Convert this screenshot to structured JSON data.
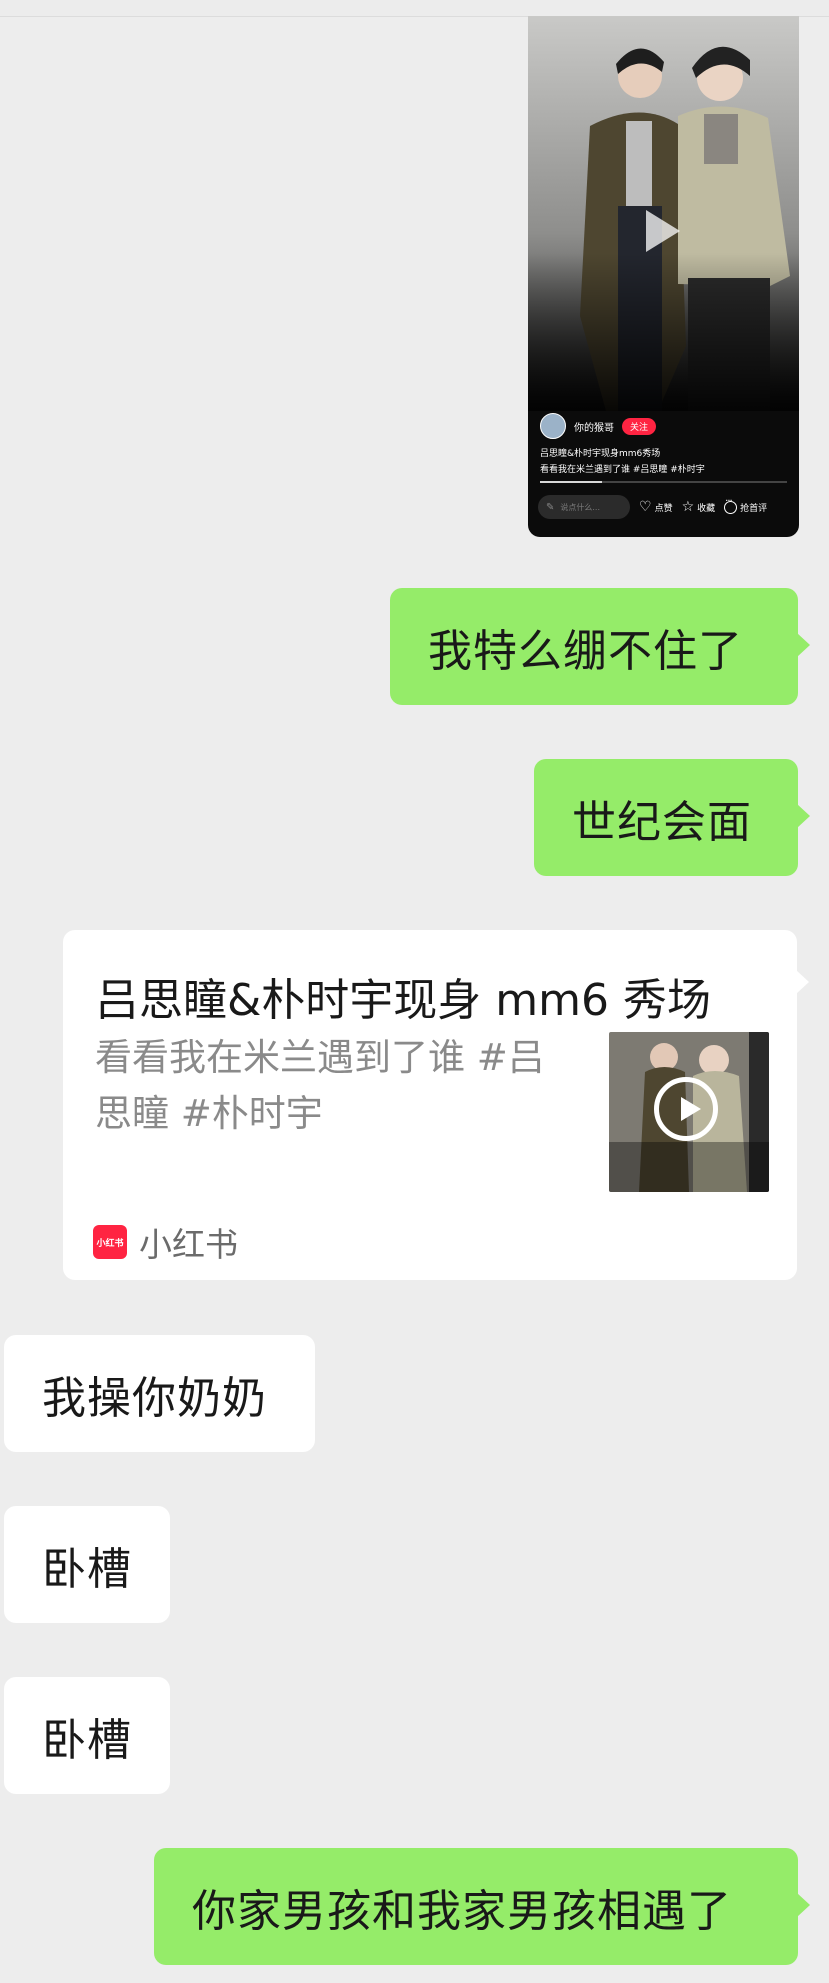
{
  "shared_video": {
    "author": "你的猴哥",
    "follow_label": "关注",
    "title": "吕思瞳&朴时宇现身mm6秀场",
    "desc": "看看我在米兰遇到了谁 #吕思瞳 #朴时宇",
    "progress": 0.25,
    "comment_placeholder": "说点什么...",
    "like_label": "点赞",
    "collect_label": "收藏",
    "comment_label": "抢首评"
  },
  "messages": [
    {
      "side": "me",
      "text": "我特么绷不住了"
    },
    {
      "side": "me",
      "text": "世纪会面"
    },
    {
      "side": "other",
      "text": "我操你奶奶"
    },
    {
      "side": "other",
      "text": "卧槽"
    },
    {
      "side": "other",
      "text": "卧槽"
    },
    {
      "side": "me",
      "text": "你家男孩和我家男孩相遇了"
    }
  ],
  "link_card": {
    "title": "吕思瞳&朴时宇现身 mm6 秀场",
    "desc": "看看我在米兰遇到了谁 #吕思瞳  #朴时宇",
    "source_logo": "小红书",
    "source_name": "小红书"
  },
  "colors": {
    "background": "#ededed",
    "my_bubble": "#95ec69",
    "other_bubble": "#ffffff",
    "brand_red": "#ff2442"
  }
}
